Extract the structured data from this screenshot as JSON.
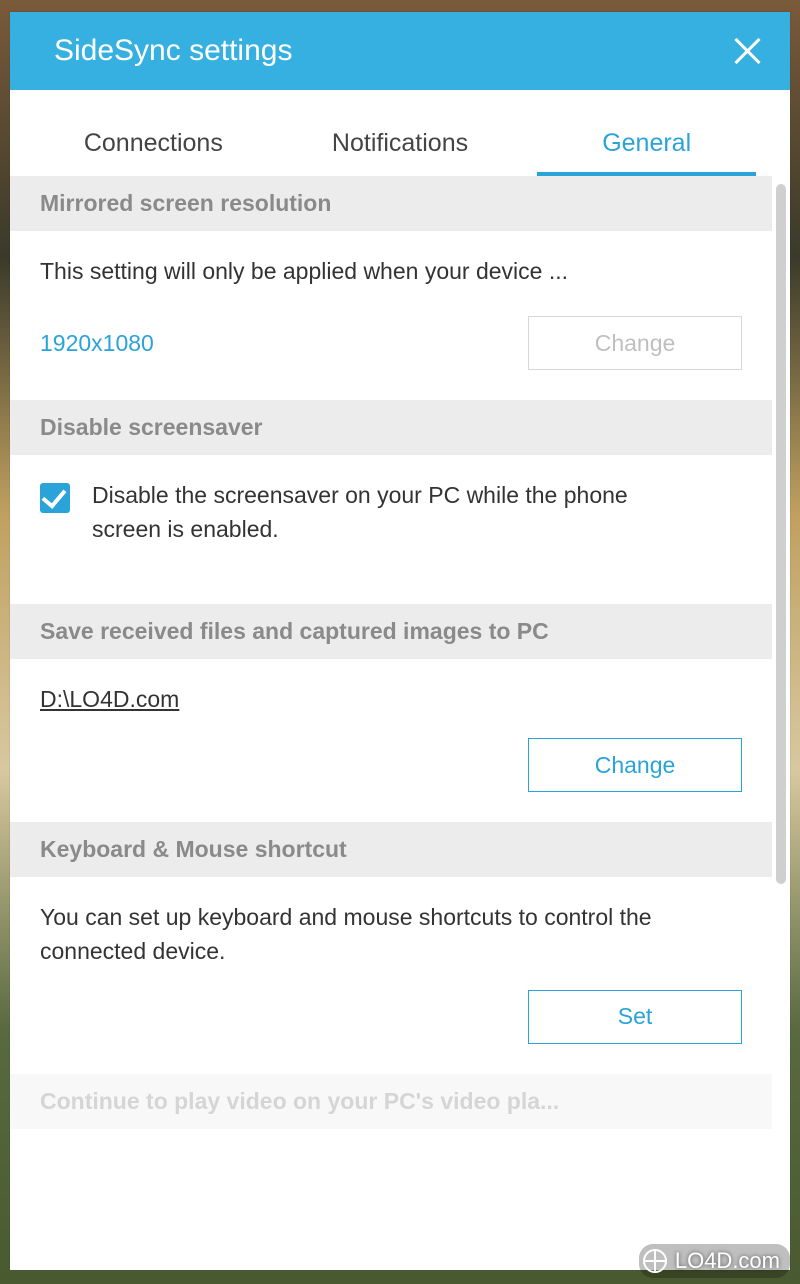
{
  "window": {
    "title": "SideSync settings"
  },
  "tabs": [
    {
      "label": "Connections"
    },
    {
      "label": "Notifications"
    },
    {
      "label": "General"
    }
  ],
  "sections": {
    "resolution": {
      "header": "Mirrored screen resolution",
      "description": "This setting will only be applied when your device ...",
      "value": "1920x1080",
      "change_label": "Change"
    },
    "screensaver": {
      "header": "Disable screensaver",
      "checkbox_label": "Disable the screensaver on your PC while the phone screen is enabled."
    },
    "savepath": {
      "header": "Save received files and captured images to PC",
      "path": "D:\\LO4D.com",
      "change_label": "Change"
    },
    "shortcut": {
      "header": "Keyboard & Mouse shortcut",
      "description": "You can set up keyboard and mouse shortcuts to control the connected device.",
      "set_label": "Set"
    },
    "continue_video": {
      "header_partial": "Continue to play video on your PC's video pla..."
    }
  },
  "watermark": "LO4D.com"
}
